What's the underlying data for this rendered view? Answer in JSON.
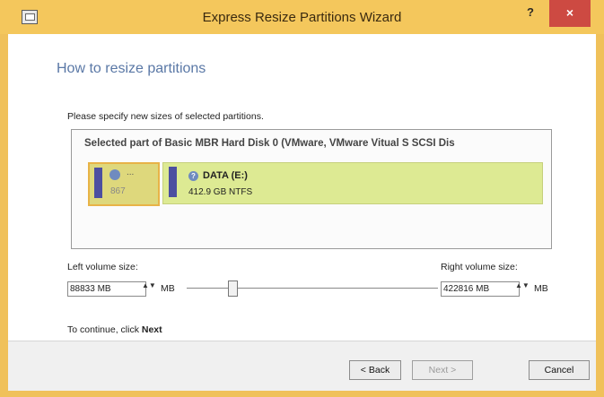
{
  "window": {
    "title": "Express Resize Partitions Wizard",
    "help_label": "?",
    "close_label": "×"
  },
  "page": {
    "heading": "How to resize partitions",
    "instruction": "Please specify new sizes of selected partitions."
  },
  "disk": {
    "title": "Selected part of Basic MBR Hard Disk 0 (VMware, VMware Vitual S SCSI Dis",
    "left_partition": {
      "label": "...",
      "size": "867"
    },
    "right_partition": {
      "icon_glyph": "?",
      "name": "DATA (E:)",
      "info": "412.9 GB NTFS"
    }
  },
  "resize": {
    "left_label": "Left volume size:",
    "left_value": "88833 MB",
    "left_unit": "MB",
    "right_label": "Right volume size:",
    "right_value": "422816 MB",
    "right_unit": "MB",
    "spin_glyph": "▲▼",
    "slider_position": 0.17
  },
  "hint": {
    "prefix": "To continue, click ",
    "emphasis": "Next"
  },
  "buttons": {
    "back": "< Back",
    "next": "Next >",
    "cancel": "Cancel"
  },
  "colors": {
    "title_bar": "#f4c75c",
    "close_button": "#cd4a42",
    "heading": "#5a78a6",
    "partition_fill": "#ddea93",
    "partition_bar": "#4c4fa0"
  }
}
